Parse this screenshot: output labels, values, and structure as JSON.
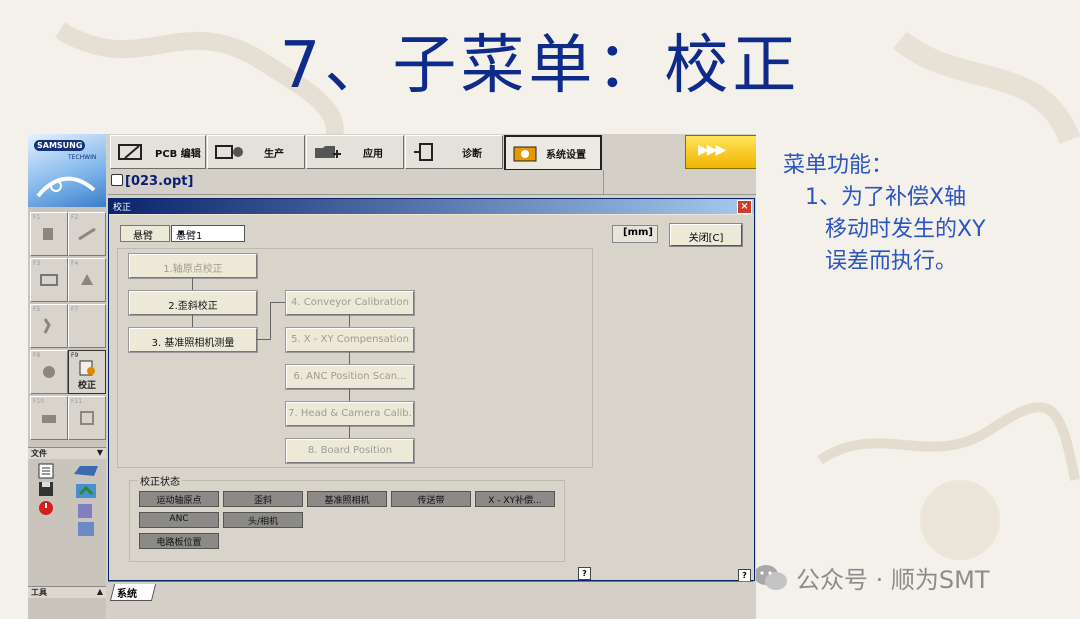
{
  "slide": {
    "title": "7、子菜单：校正",
    "notes": [
      "菜单功能：",
      "1、为了补偿X轴",
      "移动时发生的XY",
      "误差而执行。"
    ],
    "watermark": "公众号 · 顺为SMT"
  },
  "logo": {
    "brand": "SAMSUNG",
    "sub": "TECHWIN"
  },
  "top_tabs": [
    {
      "label": "PCB 编辑",
      "icon": "pcb-edit-icon"
    },
    {
      "label": "生产",
      "icon": "production-icon"
    },
    {
      "label": "应用",
      "icon": "application-icon"
    },
    {
      "label": "诊断",
      "icon": "diagnosis-icon"
    },
    {
      "label": "系统设置",
      "icon": "system-settings-icon",
      "active": true
    }
  ],
  "status": {
    "arrows": "▶▶▶",
    "state": "IDLE"
  },
  "file": {
    "name": "[023.opt]"
  },
  "function_keys": [
    {
      "key": "F1",
      "caption": ""
    },
    {
      "key": "F2",
      "caption": ""
    },
    {
      "key": "F3",
      "caption": ""
    },
    {
      "key": "F4",
      "caption": ""
    },
    {
      "key": "F5",
      "caption": ""
    },
    {
      "key": "F7",
      "caption": ""
    },
    {
      "key": "F8",
      "caption": ""
    },
    {
      "key": "F9",
      "caption": "校正"
    },
    {
      "key": "F10",
      "caption": ""
    },
    {
      "key": "F11",
      "caption": ""
    }
  ],
  "sections": {
    "file": "文件",
    "tools": "工具"
  },
  "dialog": {
    "title": "校正",
    "arm_label": "悬臂",
    "arm_value": "悬臂1",
    "unit": "[mm]",
    "close": "关闭[C]",
    "steps": {
      "s1": "1.轴原点校正",
      "s2": "2.歪斜校正",
      "s3": "3. 基准照相机测量",
      "s4": "4. Conveyor Calibration",
      "s5": "5. X - XY Compensation",
      "s6": "6. ANC Position Scan...",
      "s7": "7. Head & Camera Calib.",
      "s8": "8. Board Position"
    },
    "status_title": "校正状态",
    "status_items": [
      "运动轴原点",
      "歪斜",
      "基准照相机",
      "传送带",
      "X - XY补偿...",
      "ANC",
      "头/相机",
      "电路板位置"
    ],
    "help": "?"
  },
  "bottom_tab": "系统",
  "colors": {
    "title": "#0e2a8a",
    "note": "#2c55c0",
    "idle": "#f0b400"
  }
}
